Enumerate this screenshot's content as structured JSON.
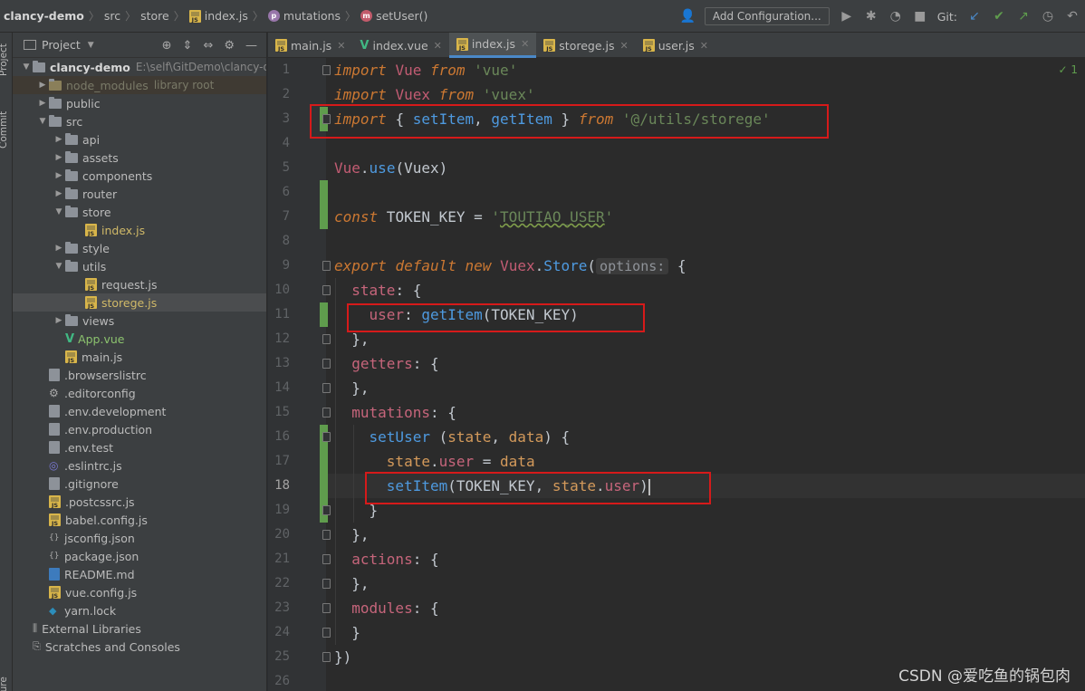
{
  "breadcrumb": [
    "clancy-demo",
    "src",
    "store",
    "index.js",
    "mutations",
    "setUser()"
  ],
  "toolbar": {
    "add_configuration": "Add Configuration...",
    "git_label": "Git:"
  },
  "left_strip": [
    "Project",
    "Commit",
    "Structure"
  ],
  "project_panel": {
    "title": "Project",
    "root_name": "clancy-demo",
    "root_path": "E:\\self\\GitDemo\\clancy-demo",
    "node_modules": "node_modules",
    "node_modules_sub": "library root",
    "tree": [
      {
        "label": "public",
        "type": "folder",
        "depth": 1,
        "open": false
      },
      {
        "label": "src",
        "type": "folder",
        "depth": 1,
        "open": true
      },
      {
        "label": "api",
        "type": "folder",
        "depth": 2,
        "open": false
      },
      {
        "label": "assets",
        "type": "folder",
        "depth": 2,
        "open": false
      },
      {
        "label": "components",
        "type": "folder",
        "depth": 2,
        "open": false
      },
      {
        "label": "router",
        "type": "folder",
        "depth": 2,
        "open": false
      },
      {
        "label": "store",
        "type": "folder",
        "depth": 2,
        "open": true
      },
      {
        "label": "index.js",
        "type": "js",
        "depth": 3
      },
      {
        "label": "style",
        "type": "folder",
        "depth": 2,
        "open": false
      },
      {
        "label": "utils",
        "type": "folder",
        "depth": 2,
        "open": true
      },
      {
        "label": "request.js",
        "type": "js-plain",
        "depth": 3
      },
      {
        "label": "storege.js",
        "type": "js",
        "depth": 3,
        "selected": true
      },
      {
        "label": "views",
        "type": "folder",
        "depth": 2,
        "open": false
      },
      {
        "label": "App.vue",
        "type": "vue",
        "depth": 2
      },
      {
        "label": "main.js",
        "type": "js-plain",
        "depth": 2
      },
      {
        "label": ".browserslistrc",
        "type": "file",
        "depth": 1
      },
      {
        "label": ".editorconfig",
        "type": "gear",
        "depth": 1
      },
      {
        "label": ".env.development",
        "type": "file",
        "depth": 1
      },
      {
        "label": ".env.production",
        "type": "file",
        "depth": 1
      },
      {
        "label": ".env.test",
        "type": "file",
        "depth": 1
      },
      {
        "label": ".eslintrc.js",
        "type": "eslint",
        "depth": 1
      },
      {
        "label": ".gitignore",
        "type": "file",
        "depth": 1
      },
      {
        "label": ".postcssrc.js",
        "type": "js-plain",
        "depth": 1
      },
      {
        "label": "babel.config.js",
        "type": "js-plain",
        "depth": 1
      },
      {
        "label": "jsconfig.json",
        "type": "json",
        "depth": 1
      },
      {
        "label": "package.json",
        "type": "json",
        "depth": 1
      },
      {
        "label": "README.md",
        "type": "md",
        "depth": 1
      },
      {
        "label": "vue.config.js",
        "type": "js-plain",
        "depth": 1
      },
      {
        "label": "yarn.lock",
        "type": "yarn",
        "depth": 1
      }
    ],
    "external_libraries": "External Libraries",
    "scratches": "Scratches and Consoles"
  },
  "tabs": [
    {
      "label": "main.js",
      "icon": "js",
      "active": false
    },
    {
      "label": "index.vue",
      "icon": "vue",
      "active": false
    },
    {
      "label": "index.js",
      "icon": "js",
      "active": true
    },
    {
      "label": "storege.js",
      "icon": "js",
      "active": false
    },
    {
      "label": "user.js",
      "icon": "js",
      "active": false
    }
  ],
  "editor": {
    "current_line": 18,
    "check_count": "1",
    "line_numbers": [
      "1",
      "2",
      "3",
      "4",
      "5",
      "6",
      "7",
      "8",
      "9",
      "10",
      "11",
      "12",
      "13",
      "14",
      "15",
      "16",
      "17",
      "18",
      "19",
      "20",
      "21",
      "22",
      "23",
      "24",
      "25",
      "26"
    ],
    "lines": {
      "l1": {
        "import": "import",
        "name": "Vue",
        "from": "from",
        "str": "'vue'"
      },
      "l2": {
        "import": "import",
        "name": "Vuex",
        "from": "from",
        "str": "'vuex'"
      },
      "l3": {
        "import": "import",
        "open": "{ ",
        "a": "setItem",
        "comma": ", ",
        "b": "getItem",
        "close": " }",
        "from": "from",
        "str": "'@/utils/storege'"
      },
      "l5": {
        "obj": "Vue",
        "dot": ".",
        "fn": "use",
        "args": "(Vuex)"
      },
      "l7": {
        "kw": "const",
        "name": " TOKEN_KEY = ",
        "q1": "'",
        "str": "TOUTIAO_USER",
        "q2": "'"
      },
      "l9": {
        "kw1": "export",
        "kw2": "default",
        "kw3": "new",
        "obj": "Vuex",
        "dot": ".",
        "fn": "Store",
        "paren": "(",
        "hint": "options:",
        "brace": " {"
      },
      "l10": {
        "key": "state",
        "rest": ": {"
      },
      "l11": {
        "key": "user",
        "colon": ": ",
        "fn": "getItem",
        "args": "(TOKEN_KEY)"
      },
      "l12": {
        "text": "},"
      },
      "l13": {
        "key": "getters",
        "rest": ": {"
      },
      "l14": {
        "text": "},"
      },
      "l15": {
        "key": "mutations",
        "rest": ": {"
      },
      "l16": {
        "fn": "setUser",
        "open": " (",
        "a": "state",
        "comma": ", ",
        "b": "data",
        "close": ") {"
      },
      "l17": {
        "obj": "state",
        "dot": ".",
        "prop": "user",
        "eq": " = ",
        "val": "data"
      },
      "l18": {
        "fn": "setItem",
        "open": "(TOKEN_KEY, ",
        "obj": "state",
        "dot": ".",
        "prop": "user",
        "close": ")"
      },
      "l19": {
        "text": "}"
      },
      "l20": {
        "text": "},"
      },
      "l21": {
        "key": "actions",
        "rest": ": {"
      },
      "l22": {
        "text": "},"
      },
      "l23": {
        "key": "modules",
        "rest": ": {"
      },
      "l24": {
        "text": "}"
      },
      "l25": {
        "text": "})"
      }
    }
  },
  "watermark": "CSDN @爱吃鱼的锅包肉"
}
